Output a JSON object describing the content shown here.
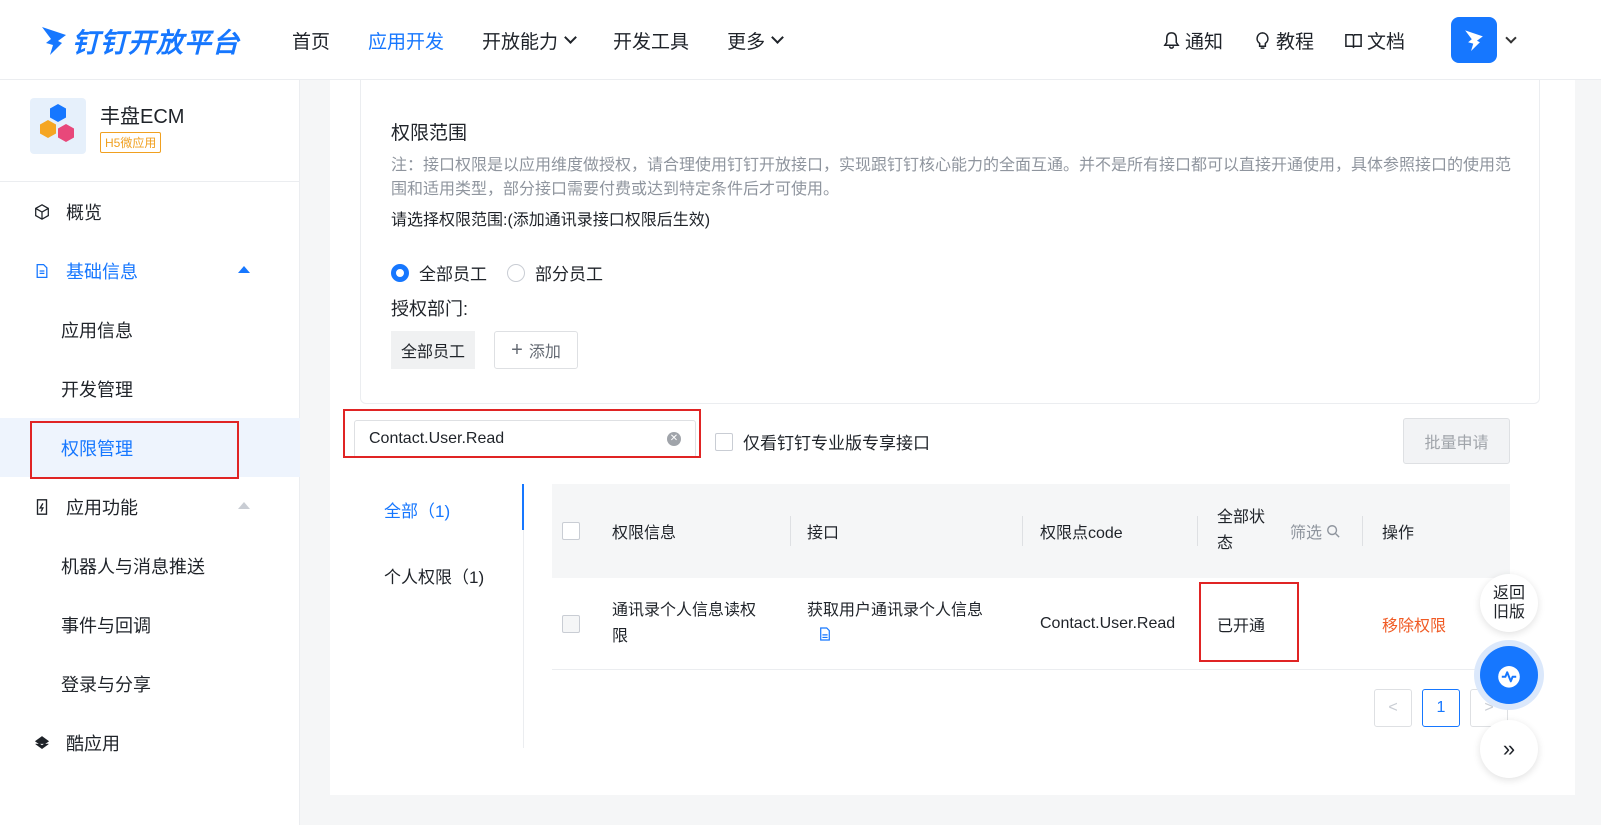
{
  "header": {
    "brand": "钉钉开放平台",
    "nav": [
      {
        "label": "首页"
      },
      {
        "label": "应用开发"
      },
      {
        "label": "开放能力"
      },
      {
        "label": "开发工具"
      },
      {
        "label": "更多"
      }
    ],
    "tools": {
      "notify": "通知",
      "tutorial": "教程",
      "docs": "文档"
    }
  },
  "sidebar": {
    "app_name": "丰盘ECM",
    "app_tag": "H5微应用",
    "items": [
      {
        "label": "概览"
      },
      {
        "label": "基础信息"
      },
      {
        "label": "应用信息"
      },
      {
        "label": "开发管理"
      },
      {
        "label": "权限管理"
      },
      {
        "label": "应用功能"
      },
      {
        "label": "机器人与消息推送"
      },
      {
        "label": "事件与回调"
      },
      {
        "label": "登录与分享"
      },
      {
        "label": "酷应用"
      }
    ]
  },
  "scope": {
    "title": "权限范围",
    "note": "注：接口权限是以应用维度做授权，请合理使用钉钉开放接口，实现跟钉钉核心能力的全面互通。并不是所有接口都可以直接开通使用，具体参照接口的使用范围和适用类型，部分接口需要付费或达到特定条件后才可使用。",
    "hint": "请选择权限范围:(添加通讯录接口权限后生效)",
    "radio_all": "全部员工",
    "radio_part": "部分员工",
    "auth_dept_label": "授权部门:",
    "dept_chip": "全部员工",
    "add_label": "添加"
  },
  "filter": {
    "search_value": "Contact.User.Read",
    "pro_only_label": "仅看钉钉专业版专享接口",
    "batch_label": "批量申请"
  },
  "categories": [
    {
      "label": "全部（1)"
    },
    {
      "label": "个人权限（1)"
    }
  ],
  "table": {
    "headers": {
      "info": "权限信息",
      "api": "接口",
      "code": "权限点code",
      "status_a": "全部状",
      "status_b": "态",
      "filter": "筛选",
      "action": "操作"
    },
    "rows": [
      {
        "info_line1": "通讯录个人信息读权",
        "info_line2": "限",
        "api": "获取用户通讯录个人信息",
        "code": "Contact.User.Read",
        "status": "已开通",
        "action": "移除权限"
      }
    ]
  },
  "pagination": {
    "prev": "<",
    "current": "1",
    "next": ">"
  },
  "float": {
    "back_old_line1": "返回",
    "back_old_line2": "旧版",
    "expand": "»"
  },
  "colors": {
    "accent": "#1677ff",
    "danger": "#f05a24",
    "highlight": "#e02424"
  }
}
